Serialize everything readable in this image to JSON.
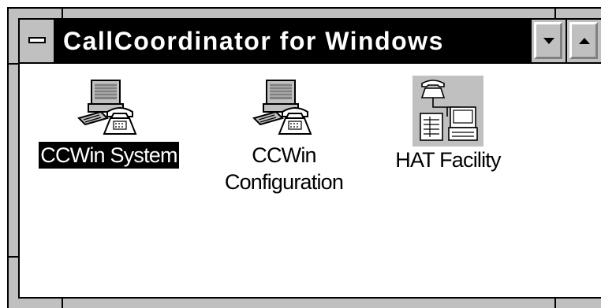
{
  "window": {
    "title": "CallCoordinator for Windows"
  },
  "icons": [
    {
      "label": "CCWin System",
      "icon": "computer-phone-icon",
      "selected": true
    },
    {
      "label_line1": "CCWin",
      "label_line2": "Configuration",
      "icon": "computer-phone-icon",
      "selected": false
    },
    {
      "label": "HAT Facility",
      "icon": "phone-network-icon",
      "selected": false
    }
  ],
  "colors": {
    "titlebar": "#000000",
    "frame": "#c0c0c0",
    "selection": "#000000"
  }
}
